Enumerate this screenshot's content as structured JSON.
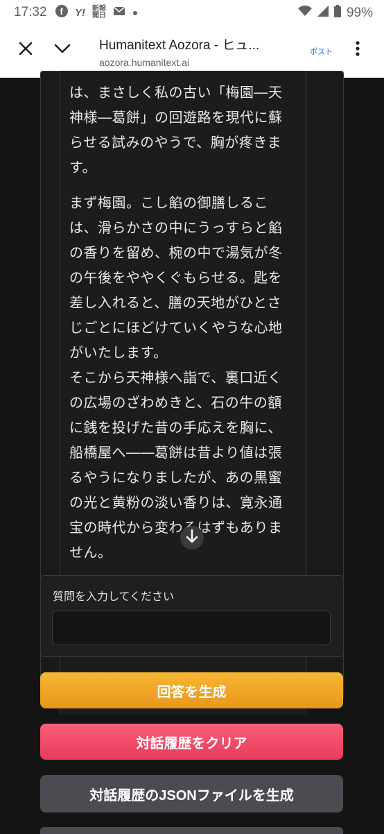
{
  "status_bar": {
    "time": "17:32",
    "app_icons": [
      "facebook-icon",
      "yahoo-icon",
      "news-icon",
      "mail-icon",
      "dot-icon"
    ],
    "yahoo_text": "Y!",
    "news_text_line1": "新報",
    "news_text_line2": "聞日",
    "battery_percent": "99%"
  },
  "browser": {
    "page_title": "Humanitext Aozora - ヒュ...",
    "url": "aozora.humanitext.ai",
    "post_label": "ポスト"
  },
  "response": {
    "paragraph1": "は、まさしく私の古い「梅園―天神様―葛餅」の回遊路を現代に蘇らせる試みのやうで、胸が疼きます。",
    "paragraph2": "まず梅園。こし餡の御膳しるこは、滑らかさの中にうっすらと餡の香りを留め、椀の中で湯気が冬の午後をややくぐもらせる。匙を差し入れると、膳の天地がひとさじごとにほどけていくやうな心地がいたします。",
    "paragraph3": "そこから天神様へ詣で、裏口近くの広場のざわめきと、石の牛の額に銭を投げた昔の手応えを胸に、船橋屋へ――葛餅は昔より値は張るやうになりましたが、あの黒蜜の光と黄粉の淡い香りは、寛永通宝の時代から変わるはずもありません。"
  },
  "question": {
    "label": "質問を入力してください",
    "value": "",
    "placeholder": ""
  },
  "buttons": {
    "generate": "回答を生成",
    "clear": "対話履歴をクリア",
    "json": "対話履歴のJSONファイルを生成"
  },
  "colors": {
    "generate": "#f0a928",
    "clear": "#f04d6b",
    "json": "#4b4c51",
    "background": "#141414"
  }
}
